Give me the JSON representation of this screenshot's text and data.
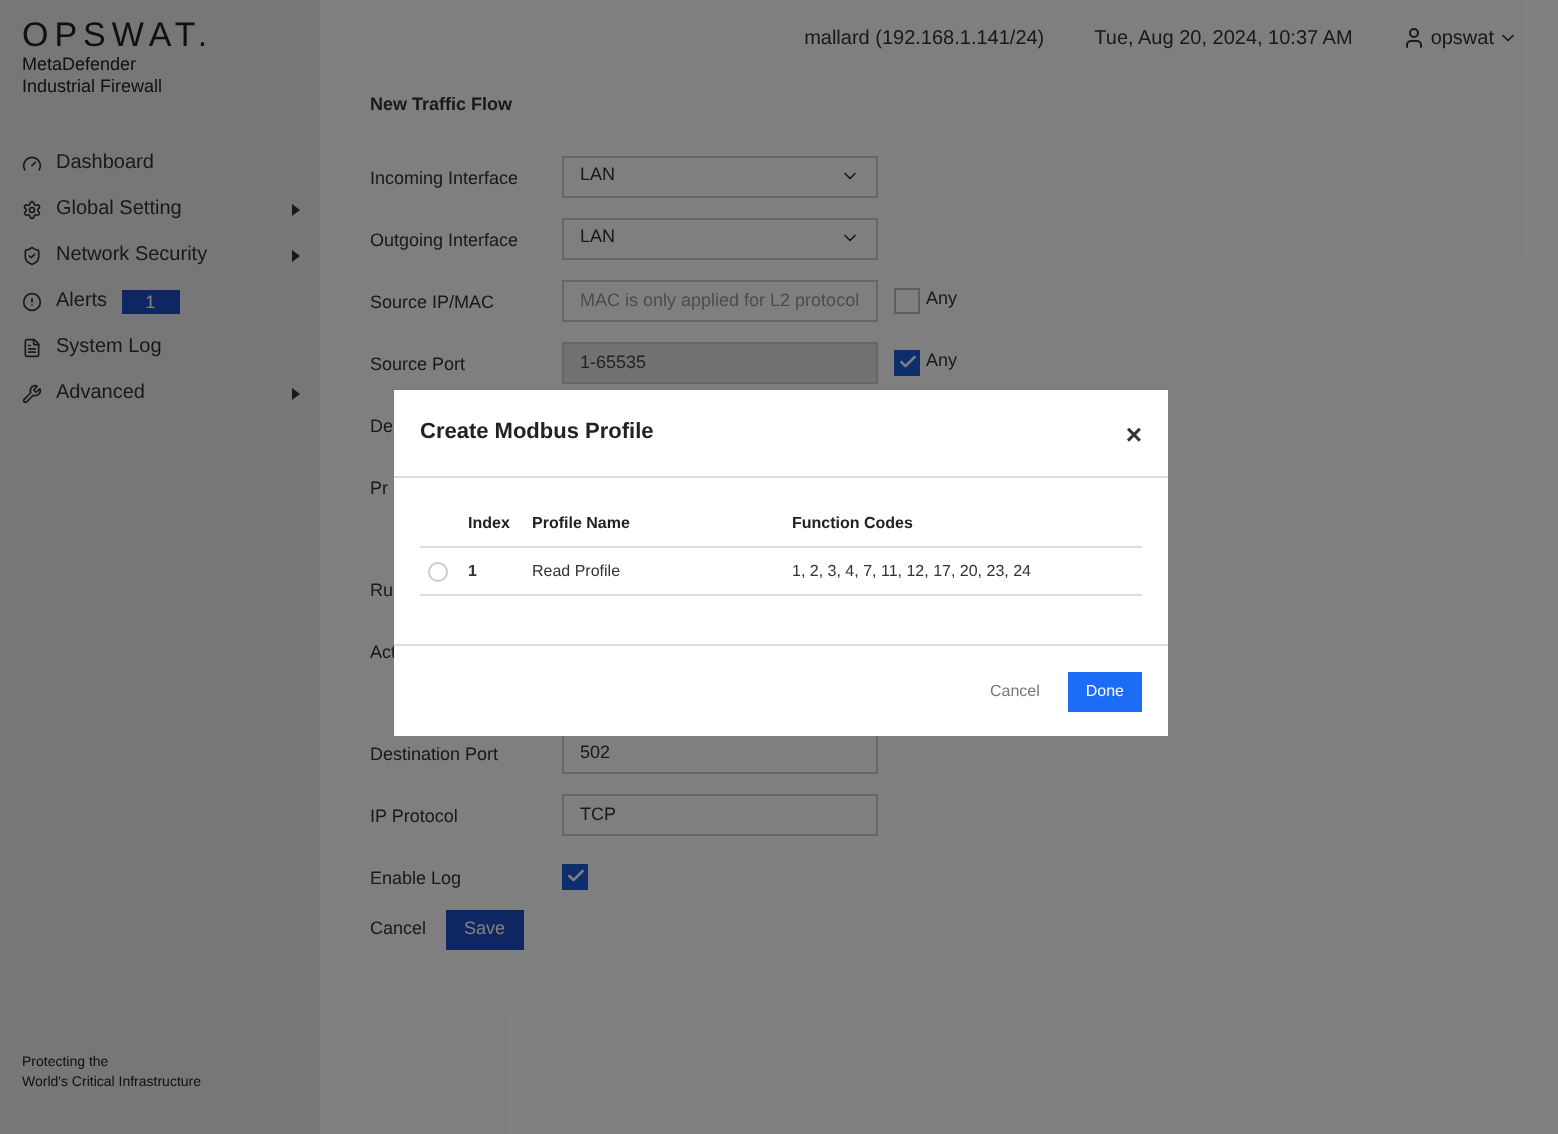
{
  "brand": {
    "logo": "OPSWAT.",
    "product_lines": [
      "MetaDefender",
      "Industrial Firewall"
    ]
  },
  "sidebar": {
    "items": [
      {
        "label": "Dashboard",
        "has_submenu": false
      },
      {
        "label": "Global Setting",
        "has_submenu": true
      },
      {
        "label": "Network Security",
        "has_submenu": true
      },
      {
        "label": "Alerts",
        "has_submenu": false,
        "badge": "1"
      },
      {
        "label": "System Log",
        "has_submenu": false
      },
      {
        "label": "Advanced",
        "has_submenu": true
      }
    ],
    "footer": [
      "Protecting the",
      "World's Critical Infrastructure"
    ]
  },
  "header": {
    "host": "mallard (192.168.1.141/24)",
    "datetime": "Tue, Aug 20, 2024, 10:37 AM",
    "user": "opswat"
  },
  "form": {
    "title": "New Traffic Flow",
    "rows": [
      {
        "kind": "select",
        "label": "Incoming Interface",
        "value": "LAN"
      },
      {
        "kind": "select",
        "label": "Outgoing Interface",
        "value": "LAN"
      },
      {
        "kind": "text",
        "label": "Source IP/MAC",
        "placeholder": "MAC is only applied for L2 protocol",
        "any_label": "Any",
        "any_checked": false
      },
      {
        "kind": "readonly",
        "label": "Source Port",
        "value": "1-65535",
        "any_label": "Any",
        "any_checked": true
      },
      {
        "kind": "partial",
        "label": "De"
      },
      {
        "kind": "partial_tall",
        "label": "Pr"
      },
      {
        "kind": "partial",
        "label": "Ru"
      },
      {
        "kind": "partial_tall",
        "label": "Act"
      },
      {
        "kind": "text_value",
        "label": "Destination Port",
        "value": "502"
      },
      {
        "kind": "text_value",
        "label": "IP Protocol",
        "value": "TCP"
      },
      {
        "kind": "checkbox",
        "label": "Enable Log",
        "checked": true
      }
    ],
    "cancel": "Cancel",
    "save": "Save"
  },
  "modal": {
    "title": "Create Modbus Profile",
    "close": "×",
    "columns": [
      "Index",
      "Profile Name",
      "Function Codes"
    ],
    "rows": [
      {
        "index": "1",
        "name": "Read Profile",
        "codes": "1, 2, 3, 4, 7, 11, 12, 17, 20, 23, 24",
        "selected": false
      }
    ],
    "cancel": "Cancel",
    "done": "Done"
  }
}
